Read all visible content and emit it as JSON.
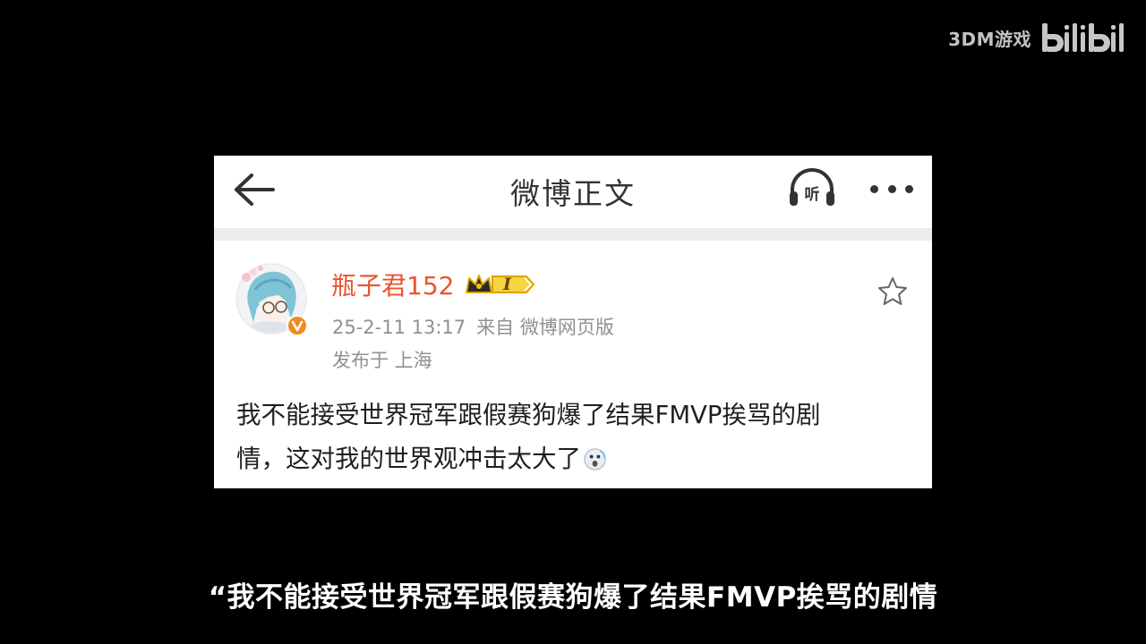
{
  "watermark": {
    "channel": "3DM游戏",
    "platform_logo": "bilibili"
  },
  "topbar": {
    "title": "微博正文",
    "listen_label": "听",
    "back_icon": "arrow-left-icon",
    "more_icon": "more-dots-icon"
  },
  "post": {
    "username": "瓶子君152",
    "timestamp": "25-2-11 13:17",
    "source": "来自 微博网页版",
    "location": "发布于 上海",
    "body_line1": "我不能接受世界冠军跟假赛狗爆了结果FMVP挨骂的剧",
    "body_line2": "情，这对我的世界观冲击太大了",
    "badge_label": "I",
    "avatar_icon": "avatar-anime",
    "verified_icon": "verified-v-icon",
    "favorite_icon": "star-outline-icon"
  },
  "subtitle": "“我不能接受世界冠军跟假赛狗爆了结果FMVP挨骂的剧情",
  "colors": {
    "background": "#000000",
    "card": "#ffffff",
    "username": "#e8542f",
    "meta": "#909090",
    "body": "#1f1f1f",
    "subtitle": "#ffffff"
  }
}
